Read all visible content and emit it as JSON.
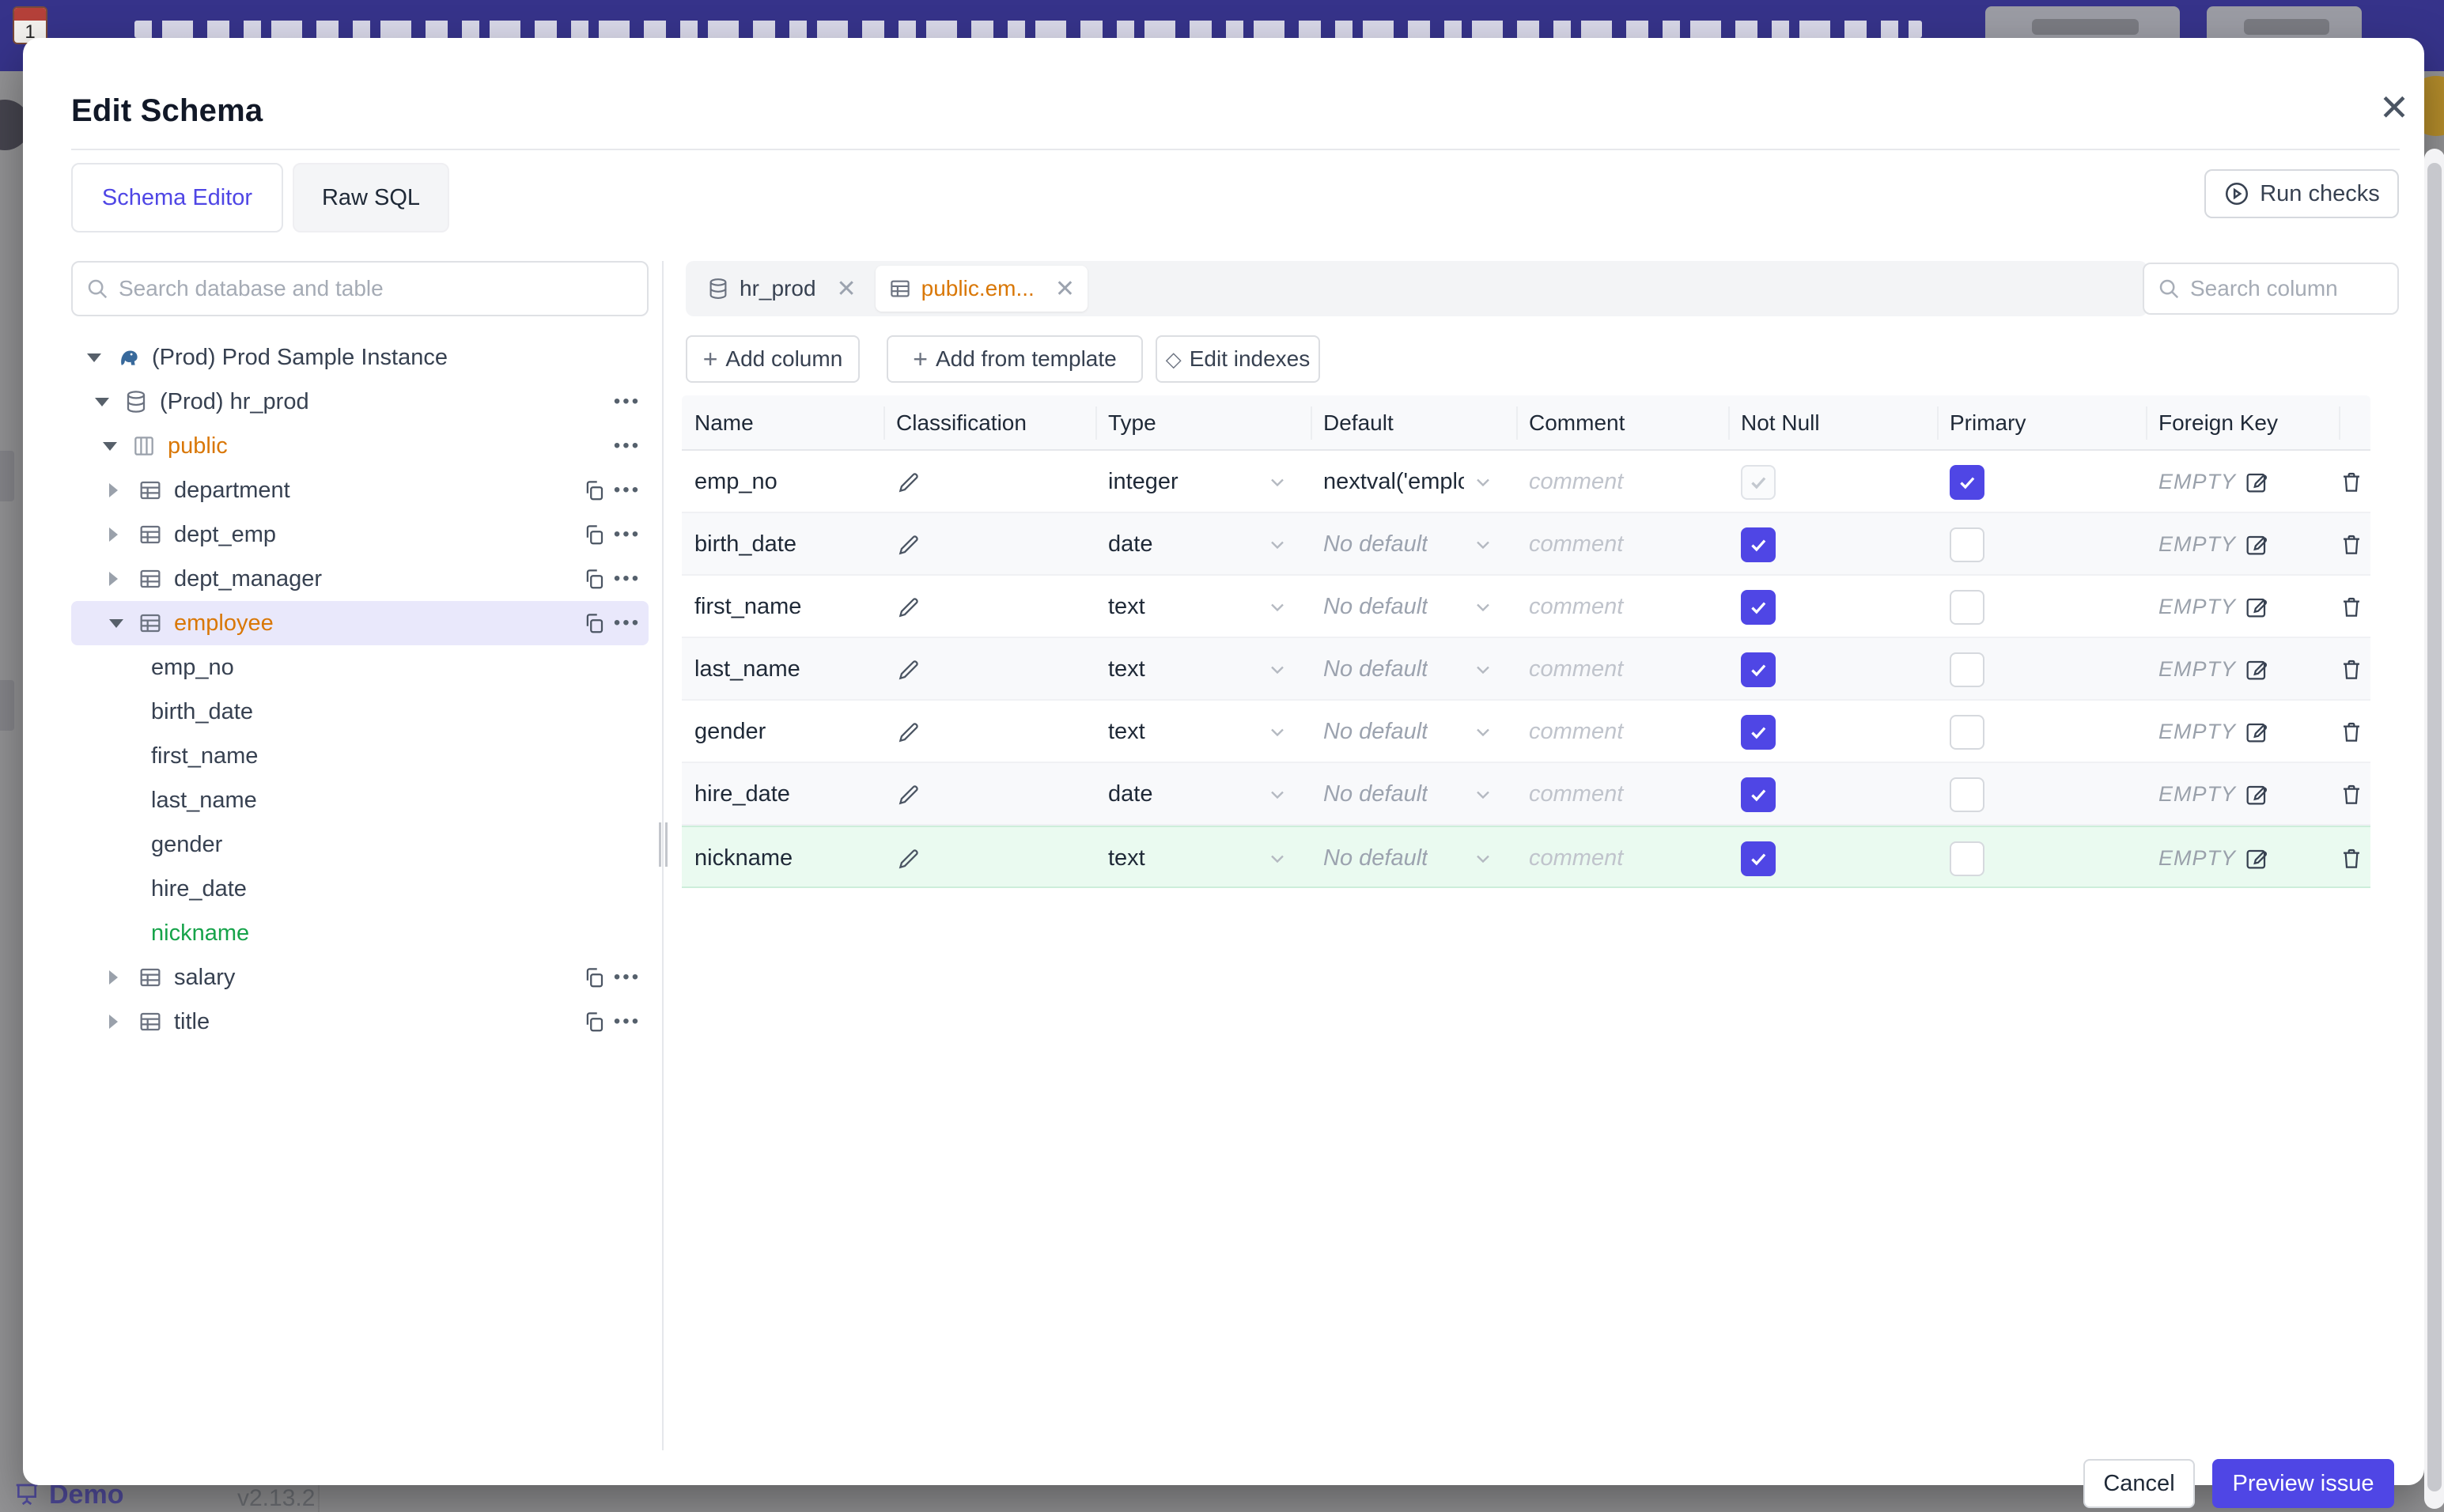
{
  "colors": {
    "accent": "#4f46e5",
    "amber": "#d97706",
    "green": "#16a34a",
    "banner": "#36338a",
    "selected_row_bg": "#e9e8fb",
    "new_row_bg": "#eafaf0"
  },
  "backdrop": {
    "demo_label": "Demo",
    "version": "v2.13.2"
  },
  "modal": {
    "title": "Edit Schema",
    "close_glyph": "✕",
    "tabs": [
      {
        "label": "Schema Editor",
        "active": true
      },
      {
        "label": "Raw SQL",
        "active": false
      }
    ],
    "run_checks_label": "Run checks",
    "sidebar": {
      "search_placeholder": "Search database and table",
      "tree": [
        {
          "label": "(Prod) Prod Sample Instance",
          "type": "instance",
          "level": 0,
          "caret": "down"
        },
        {
          "label": "(Prod) hr_prod",
          "type": "database",
          "level": 1,
          "caret": "down",
          "actions": [
            "more"
          ]
        },
        {
          "label": "public",
          "type": "schema",
          "level": 2,
          "caret": "down",
          "color": "amber",
          "actions": [
            "more"
          ]
        },
        {
          "label": "department",
          "type": "table",
          "level": 3,
          "caret": "right",
          "actions": [
            "copy",
            "more"
          ]
        },
        {
          "label": "dept_emp",
          "type": "table",
          "level": 3,
          "caret": "right",
          "actions": [
            "copy",
            "more"
          ]
        },
        {
          "label": "dept_manager",
          "type": "table",
          "level": 3,
          "caret": "right",
          "actions": [
            "copy",
            "more"
          ]
        },
        {
          "label": "employee",
          "type": "table",
          "level": 3,
          "caret": "down",
          "color": "amber",
          "selected": true,
          "actions": [
            "copy",
            "more"
          ]
        },
        {
          "label": "emp_no",
          "type": "column",
          "level": 4
        },
        {
          "label": "birth_date",
          "type": "column",
          "level": 4
        },
        {
          "label": "first_name",
          "type": "column",
          "level": 4
        },
        {
          "label": "last_name",
          "type": "column",
          "level": 4
        },
        {
          "label": "gender",
          "type": "column",
          "level": 4
        },
        {
          "label": "hire_date",
          "type": "column",
          "level": 4
        },
        {
          "label": "nickname",
          "type": "column",
          "level": 4,
          "color": "green"
        },
        {
          "label": "salary",
          "type": "table",
          "level": 3,
          "caret": "right",
          "actions": [
            "copy",
            "more"
          ]
        },
        {
          "label": "title",
          "type": "table",
          "level": 3,
          "caret": "right",
          "actions": [
            "copy",
            "more"
          ]
        }
      ]
    },
    "editor": {
      "chips": [
        {
          "label": "hr_prod",
          "icon": "database",
          "active": false
        },
        {
          "label": "public.em...",
          "icon": "table",
          "active": true,
          "color": "amber"
        }
      ],
      "toolbar": {
        "add_column": "Add column",
        "add_from_template": "Add from template",
        "edit_indexes": "Edit indexes",
        "plus_glyph": "+",
        "diamond_glyph": "◇"
      },
      "search_placeholder": "Search column",
      "table": {
        "headers": [
          "Name",
          "Classification",
          "Type",
          "Default",
          "Comment",
          "Not Null",
          "Primary",
          "Foreign Key"
        ],
        "comment_placeholder": "comment",
        "rows": [
          {
            "name": "emp_no",
            "type": "integer",
            "default": "nextval('employ",
            "default_is_set": true,
            "not_null": true,
            "not_null_disabled": true,
            "primary": true,
            "foreign_key": "EMPTY"
          },
          {
            "name": "birth_date",
            "type": "date",
            "default": "No default",
            "default_is_set": false,
            "not_null": true,
            "not_null_disabled": false,
            "primary": false,
            "foreign_key": "EMPTY"
          },
          {
            "name": "first_name",
            "type": "text",
            "default": "No default",
            "default_is_set": false,
            "not_null": true,
            "not_null_disabled": false,
            "primary": false,
            "foreign_key": "EMPTY"
          },
          {
            "name": "last_name",
            "type": "text",
            "default": "No default",
            "default_is_set": false,
            "not_null": true,
            "not_null_disabled": false,
            "primary": false,
            "foreign_key": "EMPTY"
          },
          {
            "name": "gender",
            "type": "text",
            "default": "No default",
            "default_is_set": false,
            "not_null": true,
            "not_null_disabled": false,
            "primary": false,
            "foreign_key": "EMPTY"
          },
          {
            "name": "hire_date",
            "type": "date",
            "default": "No default",
            "default_is_set": false,
            "not_null": true,
            "not_null_disabled": false,
            "primary": false,
            "foreign_key": "EMPTY"
          },
          {
            "name": "nickname",
            "type": "text",
            "default": "No default",
            "default_is_set": false,
            "not_null": true,
            "not_null_disabled": false,
            "primary": false,
            "foreign_key": "EMPTY",
            "is_new": true
          }
        ]
      }
    },
    "footer": {
      "cancel_label": "Cancel",
      "preview_label": "Preview issue"
    }
  }
}
